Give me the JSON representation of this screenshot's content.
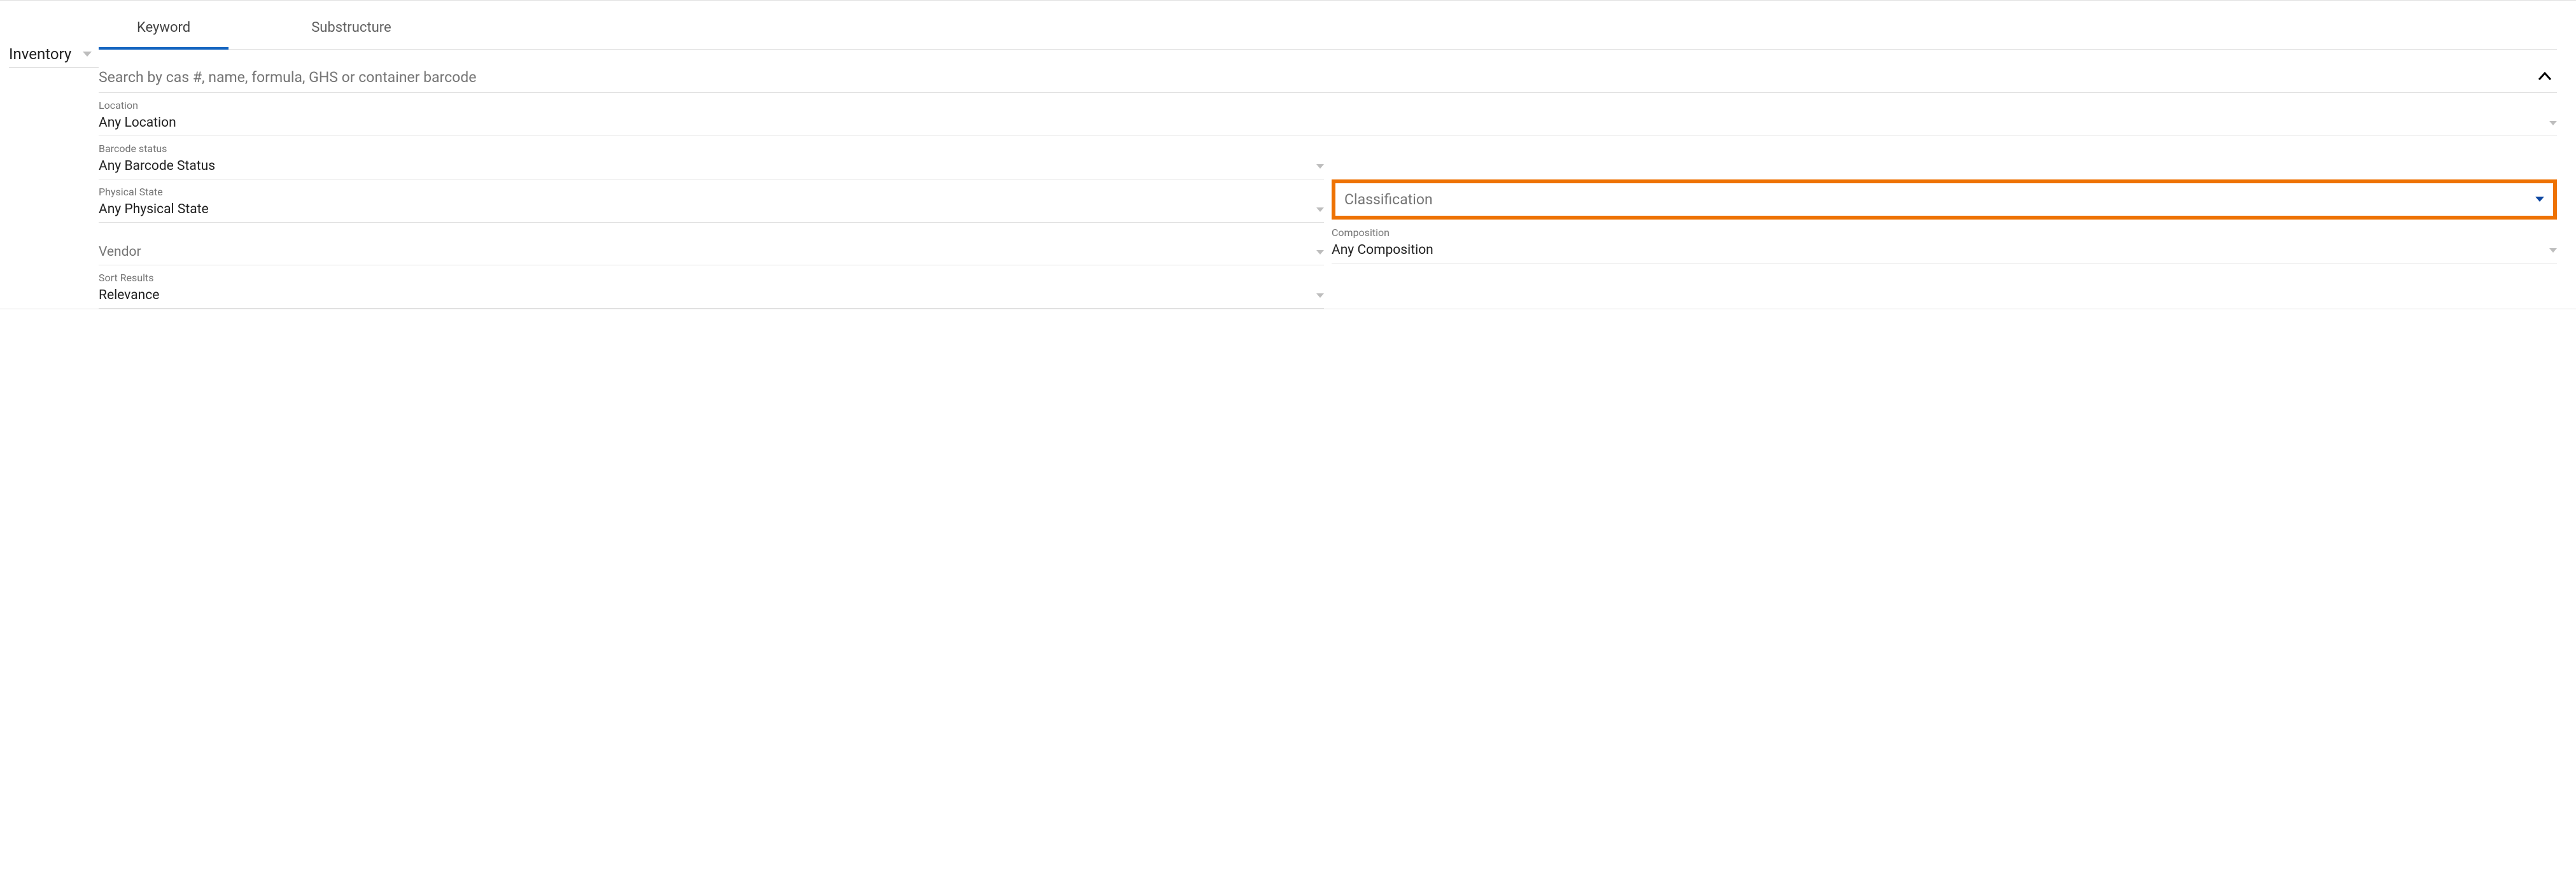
{
  "scope": {
    "label": "Inventory"
  },
  "tabs": [
    {
      "label": "Keyword",
      "active": true
    },
    {
      "label": "Substructure",
      "active": false
    }
  ],
  "search": {
    "placeholder": "Search by cas #, name, formula, GHS or container barcode",
    "value": ""
  },
  "filters": {
    "location": {
      "label": "Location",
      "value": "Any Location"
    },
    "barcode_status": {
      "label": "Barcode status",
      "value": "Any Barcode Status"
    },
    "physical_state": {
      "label": "Physical State",
      "value": "Any Physical State"
    },
    "classification": {
      "label": "Classification",
      "value": ""
    },
    "composition": {
      "label": "Composition",
      "value": "Any Composition"
    },
    "vendor": {
      "label": "Vendor",
      "value": ""
    },
    "sort_results": {
      "label": "Sort Results",
      "value": "Relevance"
    }
  }
}
